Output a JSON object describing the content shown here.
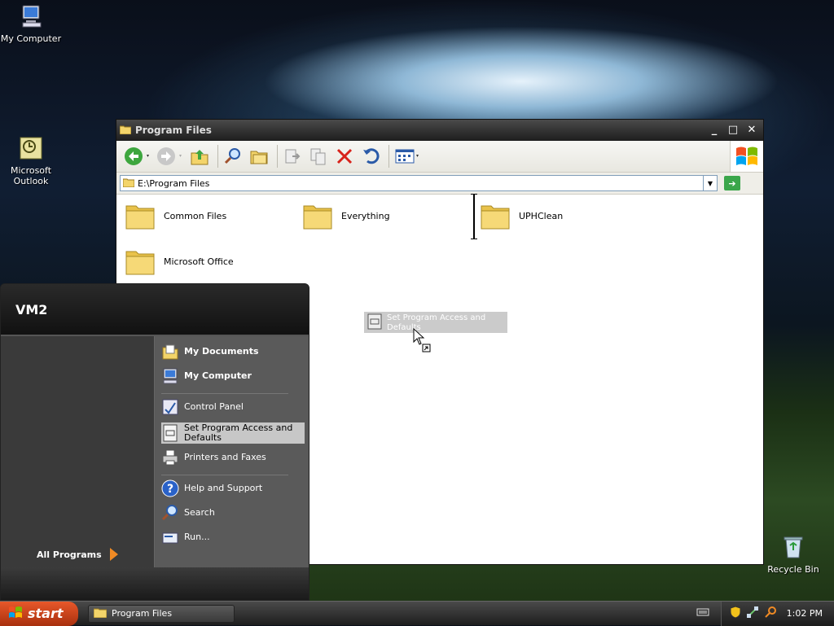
{
  "desktop": {
    "icons": [
      {
        "label": "My Computer"
      },
      {
        "label": "Microsoft Outlook"
      },
      {
        "label": "Recycle Bin"
      }
    ]
  },
  "explorer": {
    "title": "Program Files",
    "address": "E:\\Program Files",
    "folders": [
      {
        "name": "Common Files"
      },
      {
        "name": "Everything"
      },
      {
        "name": "UPHClean"
      },
      {
        "name": "Microsoft Office"
      }
    ],
    "drag_item": "Set Program Access and Defaults",
    "toolbar_icons": [
      "back-icon",
      "forward-icon",
      "up-folder-icon",
      "search-icon",
      "folders-icon",
      "move-to-icon",
      "copy-to-icon",
      "delete-icon",
      "undo-icon",
      "views-icon"
    ]
  },
  "start_menu": {
    "user": "VM2",
    "all_programs": "All Programs",
    "right_items": [
      {
        "label": "My Documents"
      },
      {
        "label": "My Computer"
      },
      {
        "label": "Control Panel"
      },
      {
        "label": "Set Program Access and Defaults"
      },
      {
        "label": "Printers and Faxes"
      },
      {
        "label": "Help and Support"
      },
      {
        "label": "Search"
      },
      {
        "label": "Run..."
      }
    ]
  },
  "taskbar": {
    "start": "start",
    "task": "Program Files",
    "clock": "1:02 PM"
  },
  "colors": {
    "accent": "#e8582a",
    "folder": "#f3d46a"
  }
}
